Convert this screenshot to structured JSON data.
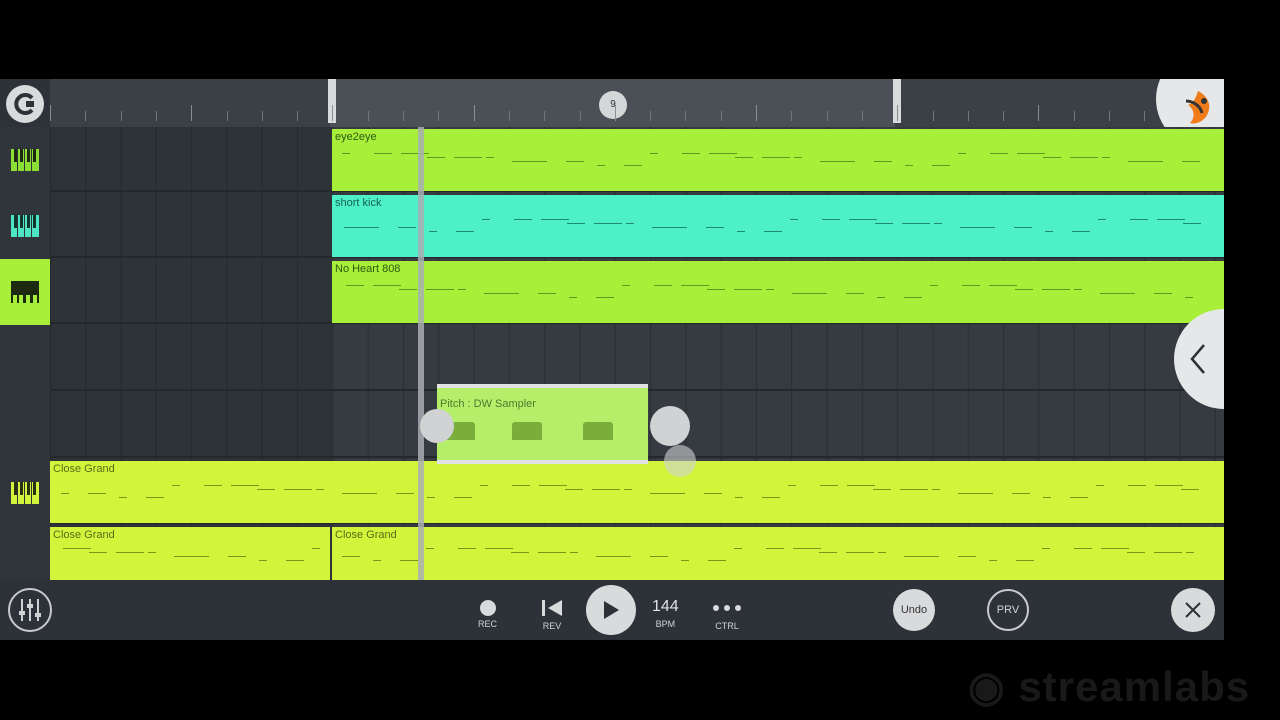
{
  "timeline": {
    "bar_number": "9"
  },
  "tracks": [
    {
      "name": "eye2eye",
      "color": "#a8ef3a"
    },
    {
      "name": "short kick",
      "color": "#4ef0c8"
    },
    {
      "name": "No Heart 808",
      "color": "#a8ef3a"
    }
  ],
  "pitch_clip": {
    "name": "Pitch : DW Sampler"
  },
  "close_grand_row1": {
    "name": "Close Grand"
  },
  "close_grand_row2": {
    "left_name": "Close Grand",
    "right_name": "Close Grand"
  },
  "transport": {
    "rec_label": "REC",
    "rev_label": "REV",
    "bpm_value": "144",
    "bpm_label": "BPM",
    "ctrl_label": "CTRL",
    "undo_label": "Undo",
    "prv_label": "PRV"
  },
  "colors": {
    "green": "#a8ef3a",
    "cyan": "#4ef0c8",
    "yellow": "#d4f43c",
    "background": "#2c3237"
  },
  "icons": [
    "magnet-icon",
    "fl-logo-icon",
    "piano-roll-icon",
    "mixer-icon",
    "record-icon",
    "rewind-icon",
    "play-icon",
    "more-icon",
    "close-icon",
    "chevron-left-icon"
  ],
  "watermark": "streamlabs"
}
